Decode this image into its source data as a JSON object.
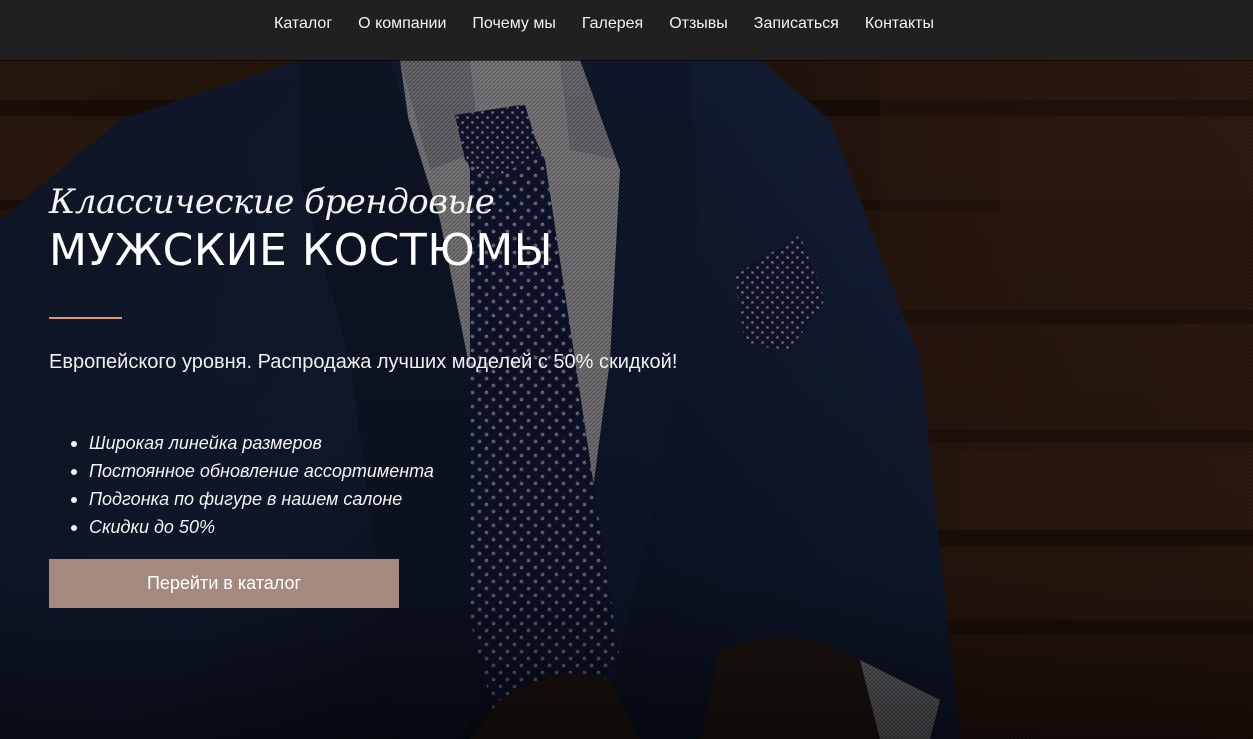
{
  "nav": {
    "items": [
      {
        "label": "Каталог"
      },
      {
        "label": "О компании"
      },
      {
        "label": "Почему мы"
      },
      {
        "label": "Галерея"
      },
      {
        "label": "Отзывы"
      },
      {
        "label": "Записаться"
      },
      {
        "label": "Контакты"
      }
    ]
  },
  "hero": {
    "title_italic": "Классические брендовые",
    "title_main": "МУЖСКИЕ КОСТЮМЫ",
    "subtitle": "Европейского уровня. Распродажа лучших моделей с 50% скидкой!",
    "features": [
      {
        "text": "Широкая линейка размеров"
      },
      {
        "text": "Постоянное обновление ассортимента"
      },
      {
        "text": "Подгонка по фигуре в нашем салоне"
      },
      {
        "text": "Скидки до 50%"
      }
    ],
    "cta_label": "Перейти в каталог",
    "background_image": "man-in-blue-suit-with-polka-dot-tie"
  },
  "colors": {
    "navbar_bg": "#202020",
    "accent_line": "#d99a7a",
    "cta_bg": "#a48a7e",
    "text": "#ffffff"
  }
}
